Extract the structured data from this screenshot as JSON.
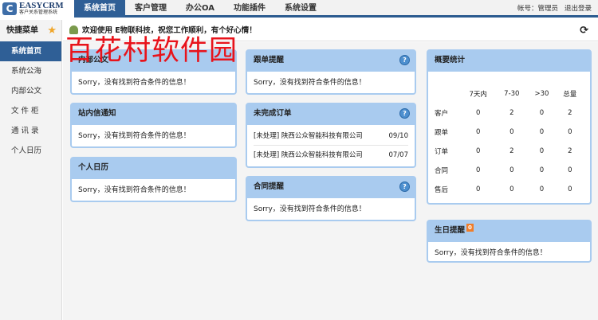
{
  "logo": {
    "icon": "C",
    "title": "EASYCRM",
    "subtitle": "客户关系管理系统"
  },
  "nav": [
    "系统首页",
    "客户管理",
    "办公OA",
    "功能插件",
    "系统设置"
  ],
  "user": {
    "account": "帐号：管理员",
    "logout": "退出登录"
  },
  "sidebar": {
    "header": "快捷菜单",
    "items": [
      "系统首页",
      "系统公海",
      "内部公文",
      "文 件 柜",
      "通 讯 录",
      "个人日历"
    ]
  },
  "welcome": "欢迎使用 E物联科技，祝您工作顺利，有个好心情！",
  "watermark": "百花村软件园",
  "empty": "Sorry，没有找到符合条件的信息！",
  "panels": {
    "doc": "内部公文",
    "msg": "站内信通知",
    "cal": "个人日历",
    "follow": "跟单提醒",
    "orders": "未完成订单",
    "contract": "合同提醒",
    "stats": "概要统计",
    "birthday": "生日提醒",
    "birthday_count": "0"
  },
  "orders": [
    {
      "text": "[未处理] 陕西公众智能科技有限公司",
      "date": "09/10"
    },
    {
      "text": "[未处理] 陕西公众智能科技有限公司",
      "date": "07/07"
    }
  ],
  "stats": {
    "headers": [
      "",
      "7天内",
      "7-30",
      ">30",
      "总量"
    ],
    "rows": [
      [
        "客户",
        "0",
        "2",
        "0",
        "2"
      ],
      [
        "跟单",
        "0",
        "0",
        "0",
        "0"
      ],
      [
        "订单",
        "0",
        "2",
        "0",
        "2"
      ],
      [
        "合同",
        "0",
        "0",
        "0",
        "0"
      ],
      [
        "售后",
        "0",
        "0",
        "0",
        "0"
      ]
    ]
  }
}
